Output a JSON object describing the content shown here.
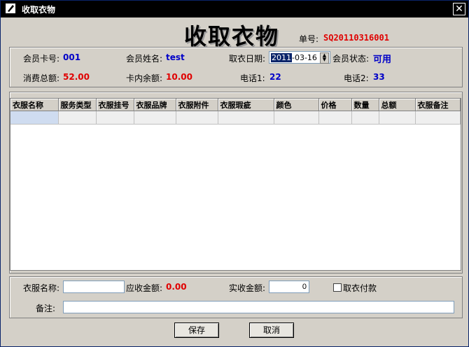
{
  "window": {
    "title": "收取衣物",
    "close": "✕"
  },
  "header": {
    "big_title": "收取衣物",
    "order_label": "单号:",
    "order_value": "SQ20110316001"
  },
  "member": {
    "card_label": "会员卡号:",
    "card_value": "001",
    "name_label": "会员姓名:",
    "name_value": "test",
    "date_label": "取衣日期:",
    "date_year": "2011",
    "date_rest": "-03-16",
    "status_label": "会员状态:",
    "status_value": "可用",
    "total_label": "消费总额:",
    "total_value": "52.00",
    "balance_label": "卡内余额:",
    "balance_value": "10.00",
    "phone1_label": "电话1:",
    "phone1_value": "22",
    "phone2_label": "电话2:",
    "phone2_value": "33"
  },
  "table": {
    "columns": [
      "衣服名称",
      "服务类型",
      "衣服挂号",
      "衣服品牌",
      "衣服附件",
      "衣服瑕疵",
      "颜色",
      "价格",
      "数量",
      "总额",
      "衣服备注"
    ]
  },
  "form": {
    "cloth_name_label": "衣服名称:",
    "cloth_name_value": "",
    "receivable_label": "应收金额:",
    "receivable_value": "0.00",
    "actual_label": "实收金额:",
    "actual_value": "0",
    "pay_label": "取衣付款",
    "remark_label": "备注:",
    "remark_value": ""
  },
  "buttons": {
    "save": "保存",
    "cancel": "取消"
  }
}
